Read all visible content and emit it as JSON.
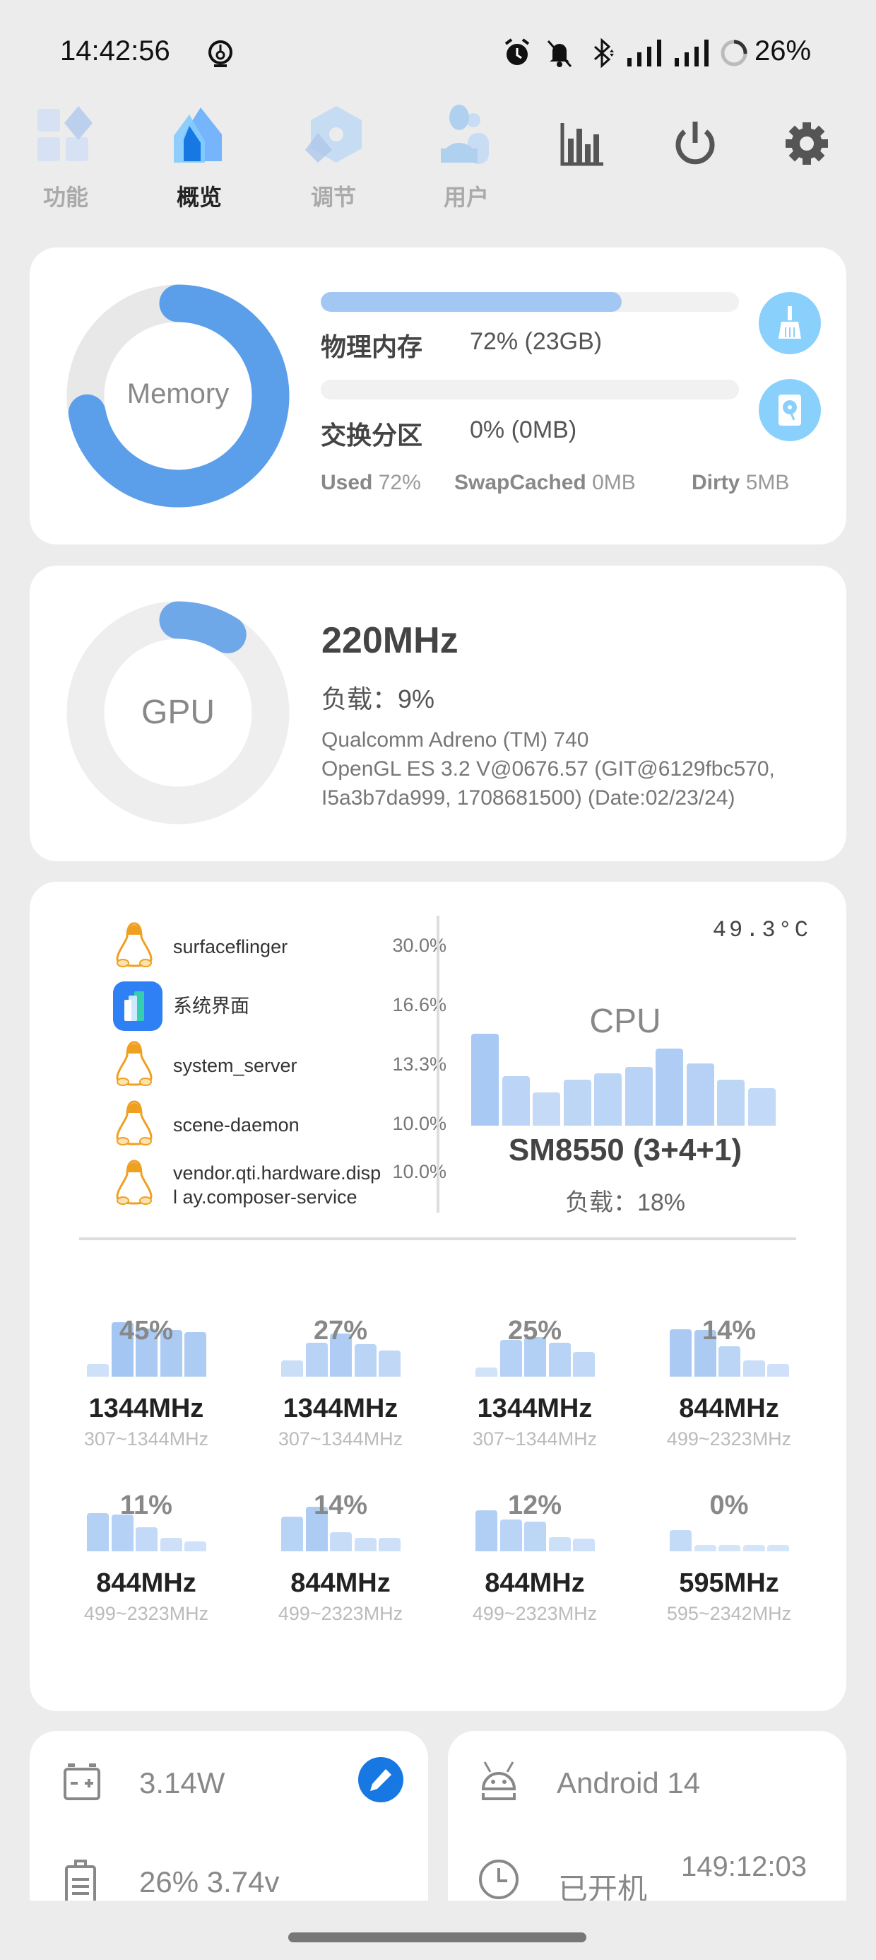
{
  "status_bar": {
    "time": "14:42:56",
    "battery": "26%",
    "battery_level": 26,
    "icons": [
      "timer-icon",
      "alarm-icon",
      "bell-off-icon",
      "bluetooth-icon",
      "signal-icon",
      "signal-icon",
      "battery-ring-icon"
    ]
  },
  "nav": {
    "tabs": [
      {
        "label": "功能",
        "icon": "grid-icon"
      },
      {
        "label": "概览",
        "icon": "home-icon",
        "active": true
      },
      {
        "label": "调节",
        "icon": "tune-icon"
      },
      {
        "label": "用户",
        "icon": "user-icon"
      }
    ],
    "actions": [
      "chart-icon",
      "power-icon",
      "gear-icon"
    ]
  },
  "memory": {
    "ring_label": "Memory",
    "used_percent": 72,
    "physical": {
      "label": "物理内存",
      "value": "72% (23GB)",
      "fill_percent": 72
    },
    "swap": {
      "label": "交换分区",
      "value": "0% (0MB)",
      "fill_percent": 0
    },
    "stats": [
      {
        "key": "Used",
        "value": "72%"
      },
      {
        "key": "SwapCached",
        "value": "0MB"
      },
      {
        "key": "Dirty",
        "value": "5MB"
      }
    ],
    "clean_icon": "broom-icon",
    "swap_icon": "disk-icon"
  },
  "gpu": {
    "ring_label": "GPU",
    "load_percent": 9,
    "freq": "220MHz",
    "load": "负载：9%",
    "info": [
      "Qualcomm Adreno (TM) 740",
      "OpenGL ES 3.2 V@0676.57 (GIT@6129fbc570,",
      "I5a3b7da999, 1708681500) (Date:02/23/24)"
    ]
  },
  "cpu": {
    "processes": [
      {
        "name": "surfaceflinger",
        "percent": "30.0%",
        "icon": "linux-icon"
      },
      {
        "name": "系统界面",
        "percent": "16.6%",
        "icon": "system-ui-icon"
      },
      {
        "name": "system_server",
        "percent": "13.3%",
        "icon": "linux-icon"
      },
      {
        "name": "scene-daemon",
        "percent": "10.0%",
        "icon": "linux-icon"
      },
      {
        "name": "vendor.qti.hardware.displ ay.composer-service",
        "percent": "10.0%",
        "icon": "linux-icon"
      }
    ],
    "temperature": "49.3°C",
    "title": "CPU",
    "chip": "SM8550 (3+4+1)",
    "load": "负载：18%",
    "history": [
      100,
      54,
      36,
      50,
      57,
      64,
      84,
      68,
      50,
      41
    ],
    "cores": [
      {
        "percent": "45%",
        "freq": "1344MHz",
        "range": "307~1344MHz",
        "history": [
          22,
          96,
          85,
          82,
          79
        ]
      },
      {
        "percent": "27%",
        "freq": "1344MHz",
        "range": "307~1344MHz",
        "history": [
          29,
          60,
          76,
          58,
          46
        ]
      },
      {
        "percent": "25%",
        "freq": "1344MHz",
        "range": "307~1344MHz",
        "history": [
          16,
          65,
          70,
          60,
          44
        ]
      },
      {
        "percent": "14%",
        "freq": "844MHz",
        "range": "499~2323MHz",
        "history": [
          84,
          82,
          54,
          29,
          22
        ]
      },
      {
        "percent": "11%",
        "freq": "844MHz",
        "range": "499~2323MHz",
        "history": [
          68,
          65,
          42,
          24,
          18
        ]
      },
      {
        "percent": "14%",
        "freq": "844MHz",
        "range": "499~2323MHz",
        "history": [
          61,
          79,
          34,
          24,
          24
        ]
      },
      {
        "percent": "12%",
        "freq": "844MHz",
        "range": "499~2323MHz",
        "history": [
          72,
          56,
          52,
          25,
          22
        ]
      },
      {
        "percent": "0%",
        "freq": "595MHz",
        "range": "595~2342MHz",
        "history": [
          38,
          11,
          11,
          11,
          11
        ]
      }
    ]
  },
  "power": {
    "watts": "3.14W",
    "battery": "26%  3.74v"
  },
  "system": {
    "android": "Android 14",
    "uptime_label": "已开机",
    "uptime": "149:12:03"
  }
}
